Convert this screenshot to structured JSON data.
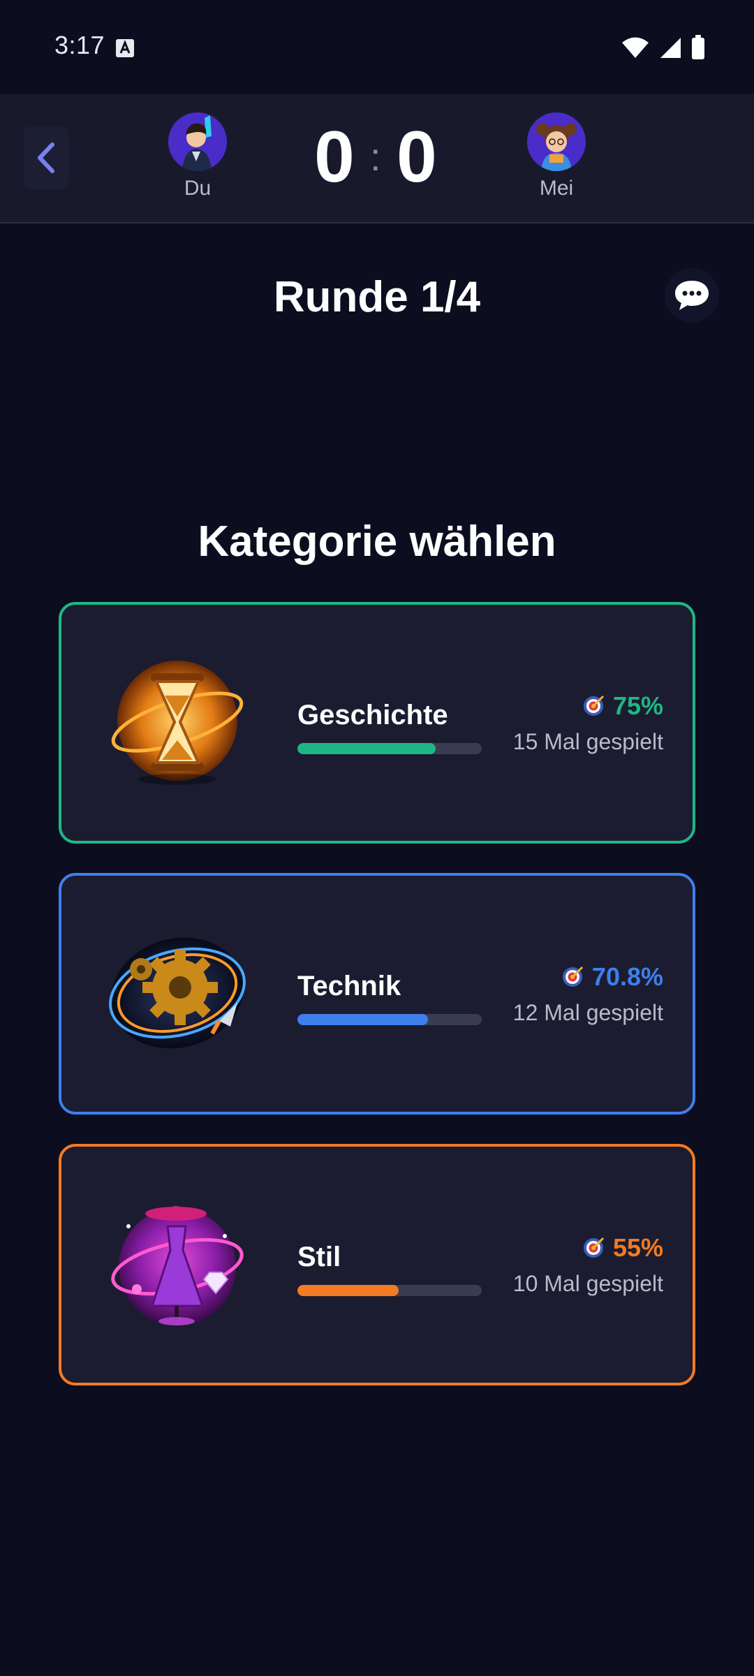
{
  "status_bar": {
    "time": "3:17",
    "icons": [
      "keyboard-a-icon",
      "wifi-icon",
      "signal-icon",
      "battery-icon"
    ]
  },
  "header": {
    "back_icon": "chevron-left-icon",
    "player_left": {
      "name": "Du",
      "score": "0"
    },
    "separator": ":",
    "player_right": {
      "name": "Mei",
      "score": "0"
    }
  },
  "round": {
    "title": "Runde 1/4",
    "chat_icon": "chat-bubble-icon"
  },
  "section": {
    "title": "Kategorie wählen"
  },
  "categories": [
    {
      "name": "Geschichte",
      "rate": "75%",
      "played": "15 Mal gespielt",
      "progress": 0.75,
      "color": "#1fb784",
      "icon": "hourglass-icon"
    },
    {
      "name": "Technik",
      "rate": "70.8%",
      "played": "12 Mal gespielt",
      "progress": 0.708,
      "color": "#3f7fec",
      "icon": "gears-icon"
    },
    {
      "name": "Stil",
      "rate": "55%",
      "played": "10 Mal gespielt",
      "progress": 0.55,
      "color": "#f47a23",
      "icon": "dress-icon"
    }
  ]
}
